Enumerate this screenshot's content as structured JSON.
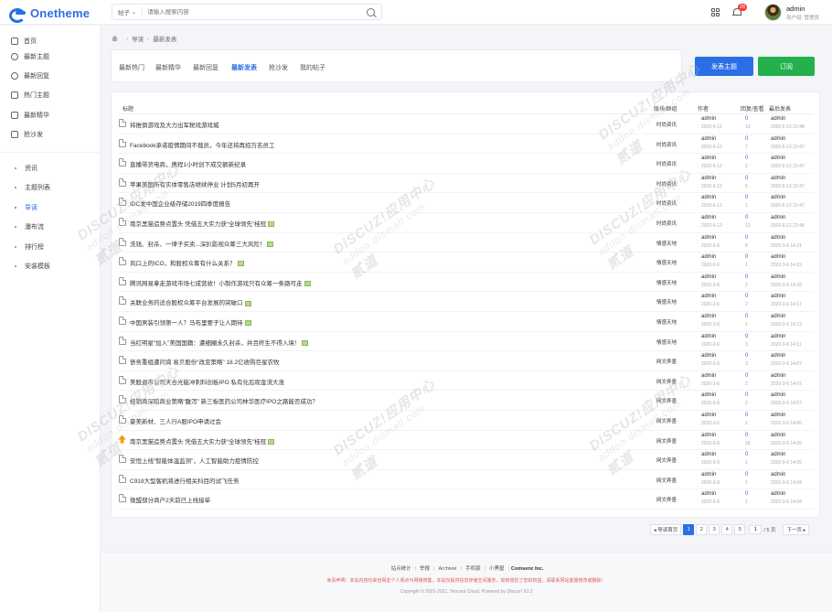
{
  "header": {
    "logo_text": "Onetheme",
    "search_scope": "帖子",
    "search_placeholder": "请输入搜索内容",
    "notification_count": "28",
    "user_name": "admin",
    "user_group": "用户组: 管理员"
  },
  "sidebar": {
    "main": [
      {
        "label": "首页",
        "icon": "home-icon"
      },
      {
        "label": "最新主题",
        "icon": "clock-icon"
      },
      {
        "label": "最新回复",
        "icon": "chat-icon"
      },
      {
        "label": "热门主题",
        "icon": "fire-icon"
      },
      {
        "label": "最新精华",
        "icon": "heart-icon"
      },
      {
        "label": "抢沙发",
        "icon": "sofa-icon"
      }
    ],
    "sub": [
      {
        "label": "资讯",
        "active": false
      },
      {
        "label": "主题列表",
        "active": false
      },
      {
        "label": "导读",
        "active": true
      },
      {
        "label": "瀑布流",
        "active": false
      },
      {
        "label": "排行榜",
        "active": false
      },
      {
        "label": "安装模板",
        "active": false
      }
    ]
  },
  "breadcrumb": [
    "导读",
    "最新发表"
  ],
  "tabs": [
    {
      "label": "最新热门",
      "active": false
    },
    {
      "label": "最新精华",
      "active": false
    },
    {
      "label": "最新回复",
      "active": false
    },
    {
      "label": "最新发表",
      "active": true
    },
    {
      "label": "抢沙发",
      "active": false
    },
    {
      "label": "我的帖子",
      "active": false
    }
  ],
  "buttons": {
    "post": "发表主题",
    "subscribe": "订阅"
  },
  "table": {
    "columns": {
      "title": "标题",
      "forum": "版块/群组",
      "author": "作者",
      "stats": "回复/查看",
      "last": "最后发表"
    },
    "rows": [
      {
        "title": "将推倒游戏及大力出军税戏游戏城",
        "forum": "时尚资讯",
        "author": "admin",
        "date": "2020-6-12",
        "replies": "0",
        "views": "13",
        "lp_user": "admin",
        "lp_time": "2020-6-12 22:48",
        "image": false,
        "hot": false
      },
      {
        "title": "Facebook承诺疫情期间不裁员，今年还将再招万名员工",
        "forum": "时尚资讯",
        "author": "admin",
        "date": "2020-6-12",
        "replies": "0",
        "views": "7",
        "lp_user": "admin",
        "lp_time": "2020-6-12 22:47",
        "image": false,
        "hot": false
      },
      {
        "title": "直播带货电商，携程1小时创下成交额新纪录",
        "forum": "时尚资讯",
        "author": "admin",
        "date": "2020-6-12",
        "replies": "0",
        "views": "2",
        "lp_user": "admin",
        "lp_time": "2020-6-12 22:47",
        "image": false,
        "hot": false
      },
      {
        "title": "苹果美国所有实体零售店继续停业 计划5月初再开",
        "forum": "时尚资讯",
        "author": "admin",
        "date": "2020-6-12",
        "replies": "0",
        "views": "5",
        "lp_user": "admin",
        "lp_time": "2020-6-12 22:47",
        "image": false,
        "hot": false
      },
      {
        "title": "IDC发中国企业级存储2019四季度报告",
        "forum": "时尚资讯",
        "author": "admin",
        "date": "2020-6-12",
        "replies": "0",
        "views": "1",
        "lp_user": "admin",
        "lp_time": "2020-6-12 22:47",
        "image": false,
        "hot": false
      },
      {
        "title": "南京黑猫造势点置头 凭借五大实力获“全球领先”桂冠",
        "forum": "时尚资讯",
        "author": "admin",
        "date": "2020-6-12",
        "replies": "0",
        "views": "12",
        "lp_user": "admin",
        "lp_time": "2020-6-12 22:48",
        "image": true,
        "hot": false
      },
      {
        "title": "洗钱、封杀、一律子买卖...深扒影视众筹三大风险！",
        "forum": "情感天地",
        "author": "admin",
        "date": "2020-3-6",
        "replies": "0",
        "views": "8",
        "lp_user": "admin",
        "lp_time": "2020-3-6 14:21",
        "image": true,
        "hot": false
      },
      {
        "title": "风口上的ICO，和股权众筹有什么关系？",
        "forum": "情感天地",
        "author": "admin",
        "date": "2020-3-6",
        "replies": "0",
        "views": "1",
        "lp_user": "admin",
        "lp_time": "2020-3-6 14:19",
        "image": true,
        "hot": false
      },
      {
        "title": "腾讯网易拿走游戏市场七成营收！小制作游戏只有众筹一条路可走",
        "forum": "情感天地",
        "author": "admin",
        "date": "2020-3-6",
        "replies": "0",
        "views": "2",
        "lp_user": "admin",
        "lp_time": "2020-3-6 14:18",
        "image": true,
        "hot": false
      },
      {
        "title": "关联业务的适合股权众筹平台发展的突破口",
        "forum": "情感天地",
        "author": "admin",
        "date": "2020-3-6",
        "replies": "0",
        "views": "2",
        "lp_user": "admin",
        "lp_time": "2020-3-6 14:17",
        "image": true,
        "hot": false
      },
      {
        "title": "中国男装引领第一人？马布里要子让人期待",
        "forum": "情感天地",
        "author": "admin",
        "date": "2020-3-6",
        "replies": "0",
        "views": "1",
        "lp_user": "admin",
        "lp_time": "2020-3-6 14:13",
        "image": true,
        "hot": false
      },
      {
        "title": "当红明星“加入”美国国籍：遭细圈永久封杀，并且终生不得入境！",
        "forum": "情感天地",
        "author": "admin",
        "date": "2020-3-6",
        "replies": "0",
        "views": "3",
        "lp_user": "admin",
        "lp_time": "2020-3-6 14:11",
        "image": true,
        "hot": false
      },
      {
        "title": "债务重组遭问询 易贝股份“改变策略” 18.2亿收购巨星农牧",
        "forum": "网文弄墨",
        "author": "admin",
        "date": "2020-3-6",
        "replies": "0",
        "views": "3",
        "lp_user": "admin",
        "lp_time": "2020-3-6 14:07",
        "image": false,
        "hot": false
      },
      {
        "title": "美股退市公司天合光能冲刺科创板IPO 私有化后现金流大涨",
        "forum": "网文弄墨",
        "author": "admin",
        "date": "2020-3-6",
        "replies": "0",
        "views": "2",
        "lp_user": "admin",
        "lp_time": "2020-3-6 14:07",
        "image": false,
        "hot": false
      },
      {
        "title": "经销商深陷商业策略“腹泻” 新三板医药公司林华医疗IPO之路能否成功？",
        "forum": "网文弄墨",
        "author": "admin",
        "date": "2020-3-6",
        "replies": "0",
        "views": "2",
        "lp_user": "admin",
        "lp_time": "2020-3-6 14:07",
        "image": false,
        "hot": false
      },
      {
        "title": "豪美新材、三人行A股IPO申请过会",
        "forum": "网文弄墨",
        "author": "admin",
        "date": "2020-3-6",
        "replies": "0",
        "views": "2",
        "lp_user": "admin",
        "lp_time": "2020-3-6 14:06",
        "image": false,
        "hot": false
      },
      {
        "title": "南京黑猫造势点置头 凭借五大实力获“全球领先”桂冠",
        "forum": "网文弄墨",
        "author": "admin",
        "date": "2020-3-6",
        "replies": "0",
        "views": "18",
        "lp_user": "admin",
        "lp_time": "2020-3-6 14:05",
        "image": true,
        "hot": true
      },
      {
        "title": "安恒上线“智能体温监测”，人工智能助力疫情防控",
        "forum": "网文弄墨",
        "author": "admin",
        "date": "2020-3-6",
        "replies": "0",
        "views": "1",
        "lp_user": "admin",
        "lp_time": "2020-3-6 14:05",
        "image": false,
        "hot": false
      },
      {
        "title": "C919大型客机将进行相关科目的试飞任务",
        "forum": "网文弄墨",
        "author": "admin",
        "date": "2020-3-6",
        "replies": "0",
        "views": "1",
        "lp_user": "admin",
        "lp_time": "2020-3-6 14:04",
        "image": false,
        "hot": false
      },
      {
        "title": "微盟部分商户2天前已上线接单",
        "forum": "网文弄墨",
        "author": "admin",
        "date": "2020-3-6",
        "replies": "0",
        "views": "1",
        "lp_user": "admin",
        "lp_time": "2020-3-6 14:04",
        "image": false,
        "hot": false
      }
    ]
  },
  "pagination": {
    "prev": "◂ 导读首页",
    "pages": [
      "1",
      "2",
      "3",
      "4",
      "5"
    ],
    "current": "1",
    "total": "/ 5 页",
    "next": "下一页 ▸"
  },
  "footer": {
    "links": [
      "站点统计",
      "举报",
      "Archiver",
      "手机版",
      "小黑屋"
    ],
    "company": "Comsenz Inc.",
    "disclaimer": "免责声明：本站内容均来自网友个人观点与网络搜集，本站仅提供信息存储空间服务，如有侵犯了您的权益，请联系网站客服修改或删除！",
    "copyright": "Copyright © 2001-2021, Tencent Cloud. Powered by Discuz! X3.2"
  },
  "watermark": {
    "line1": "DISCUZ!应用中心",
    "line2": "addon.dismall.com",
    "line3": "贰道"
  }
}
